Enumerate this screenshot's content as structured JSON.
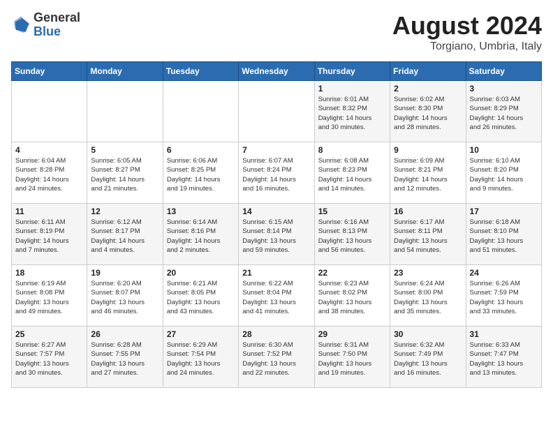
{
  "header": {
    "logo_general": "General",
    "logo_blue": "Blue",
    "month": "August 2024",
    "location": "Torgiano, Umbria, Italy"
  },
  "weekdays": [
    "Sunday",
    "Monday",
    "Tuesday",
    "Wednesday",
    "Thursday",
    "Friday",
    "Saturday"
  ],
  "weeks": [
    [
      {
        "day": "",
        "text": ""
      },
      {
        "day": "",
        "text": ""
      },
      {
        "day": "",
        "text": ""
      },
      {
        "day": "",
        "text": ""
      },
      {
        "day": "1",
        "text": "Sunrise: 6:01 AM\nSunset: 8:32 PM\nDaylight: 14 hours\nand 30 minutes."
      },
      {
        "day": "2",
        "text": "Sunrise: 6:02 AM\nSunset: 8:30 PM\nDaylight: 14 hours\nand 28 minutes."
      },
      {
        "day": "3",
        "text": "Sunrise: 6:03 AM\nSunset: 8:29 PM\nDaylight: 14 hours\nand 26 minutes."
      }
    ],
    [
      {
        "day": "4",
        "text": "Sunrise: 6:04 AM\nSunset: 8:28 PM\nDaylight: 14 hours\nand 24 minutes."
      },
      {
        "day": "5",
        "text": "Sunrise: 6:05 AM\nSunset: 8:27 PM\nDaylight: 14 hours\nand 21 minutes."
      },
      {
        "day": "6",
        "text": "Sunrise: 6:06 AM\nSunset: 8:25 PM\nDaylight: 14 hours\nand 19 minutes."
      },
      {
        "day": "7",
        "text": "Sunrise: 6:07 AM\nSunset: 8:24 PM\nDaylight: 14 hours\nand 16 minutes."
      },
      {
        "day": "8",
        "text": "Sunrise: 6:08 AM\nSunset: 8:23 PM\nDaylight: 14 hours\nand 14 minutes."
      },
      {
        "day": "9",
        "text": "Sunrise: 6:09 AM\nSunset: 8:21 PM\nDaylight: 14 hours\nand 12 minutes."
      },
      {
        "day": "10",
        "text": "Sunrise: 6:10 AM\nSunset: 8:20 PM\nDaylight: 14 hours\nand 9 minutes."
      }
    ],
    [
      {
        "day": "11",
        "text": "Sunrise: 6:11 AM\nSunset: 8:19 PM\nDaylight: 14 hours\nand 7 minutes."
      },
      {
        "day": "12",
        "text": "Sunrise: 6:12 AM\nSunset: 8:17 PM\nDaylight: 14 hours\nand 4 minutes."
      },
      {
        "day": "13",
        "text": "Sunrise: 6:14 AM\nSunset: 8:16 PM\nDaylight: 14 hours\nand 2 minutes."
      },
      {
        "day": "14",
        "text": "Sunrise: 6:15 AM\nSunset: 8:14 PM\nDaylight: 13 hours\nand 59 minutes."
      },
      {
        "day": "15",
        "text": "Sunrise: 6:16 AM\nSunset: 8:13 PM\nDaylight: 13 hours\nand 56 minutes."
      },
      {
        "day": "16",
        "text": "Sunrise: 6:17 AM\nSunset: 8:11 PM\nDaylight: 13 hours\nand 54 minutes."
      },
      {
        "day": "17",
        "text": "Sunrise: 6:18 AM\nSunset: 8:10 PM\nDaylight: 13 hours\nand 51 minutes."
      }
    ],
    [
      {
        "day": "18",
        "text": "Sunrise: 6:19 AM\nSunset: 8:08 PM\nDaylight: 13 hours\nand 49 minutes."
      },
      {
        "day": "19",
        "text": "Sunrise: 6:20 AM\nSunset: 8:07 PM\nDaylight: 13 hours\nand 46 minutes."
      },
      {
        "day": "20",
        "text": "Sunrise: 6:21 AM\nSunset: 8:05 PM\nDaylight: 13 hours\nand 43 minutes."
      },
      {
        "day": "21",
        "text": "Sunrise: 6:22 AM\nSunset: 8:04 PM\nDaylight: 13 hours\nand 41 minutes."
      },
      {
        "day": "22",
        "text": "Sunrise: 6:23 AM\nSunset: 8:02 PM\nDaylight: 13 hours\nand 38 minutes."
      },
      {
        "day": "23",
        "text": "Sunrise: 6:24 AM\nSunset: 8:00 PM\nDaylight: 13 hours\nand 35 minutes."
      },
      {
        "day": "24",
        "text": "Sunrise: 6:26 AM\nSunset: 7:59 PM\nDaylight: 13 hours\nand 33 minutes."
      }
    ],
    [
      {
        "day": "25",
        "text": "Sunrise: 6:27 AM\nSunset: 7:57 PM\nDaylight: 13 hours\nand 30 minutes."
      },
      {
        "day": "26",
        "text": "Sunrise: 6:28 AM\nSunset: 7:55 PM\nDaylight: 13 hours\nand 27 minutes."
      },
      {
        "day": "27",
        "text": "Sunrise: 6:29 AM\nSunset: 7:54 PM\nDaylight: 13 hours\nand 24 minutes."
      },
      {
        "day": "28",
        "text": "Sunrise: 6:30 AM\nSunset: 7:52 PM\nDaylight: 13 hours\nand 22 minutes."
      },
      {
        "day": "29",
        "text": "Sunrise: 6:31 AM\nSunset: 7:50 PM\nDaylight: 13 hours\nand 19 minutes."
      },
      {
        "day": "30",
        "text": "Sunrise: 6:32 AM\nSunset: 7:49 PM\nDaylight: 13 hours\nand 16 minutes."
      },
      {
        "day": "31",
        "text": "Sunrise: 6:33 AM\nSunset: 7:47 PM\nDaylight: 13 hours\nand 13 minutes."
      }
    ]
  ]
}
